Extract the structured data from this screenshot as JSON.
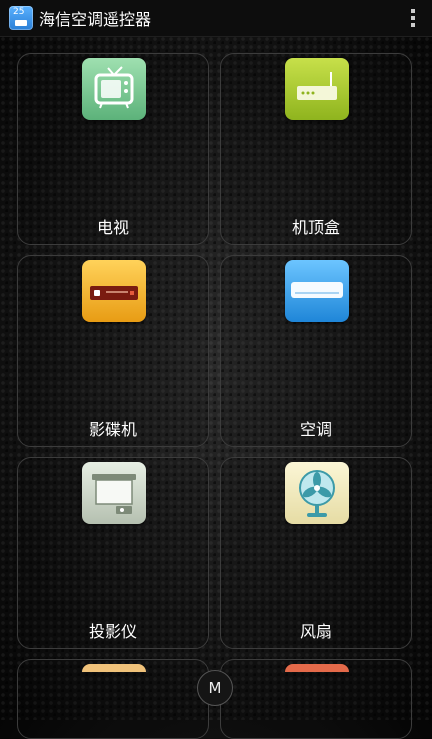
{
  "app": {
    "title": "海信空调遥控器",
    "icon_badge": "25",
    "menu_icon": "overflow-menu-icon"
  },
  "devices": [
    {
      "label": "电视",
      "icon": "tv-icon"
    },
    {
      "label": "机顶盒",
      "icon": "set-top-box-icon"
    },
    {
      "label": "影碟机",
      "icon": "dvd-player-icon"
    },
    {
      "label": "空调",
      "icon": "air-conditioner-icon"
    },
    {
      "label": "投影仪",
      "icon": "projector-icon"
    },
    {
      "label": "风扇",
      "icon": "fan-icon"
    }
  ],
  "bottom": {
    "m_label": "M"
  },
  "colors": {
    "tv": "#7cc893",
    "stb": "#a7c934",
    "dvd": "#f3b43a",
    "ac": "#3aa3ef",
    "projector": "#d3ddd0",
    "fan": "#f1e9be"
  }
}
